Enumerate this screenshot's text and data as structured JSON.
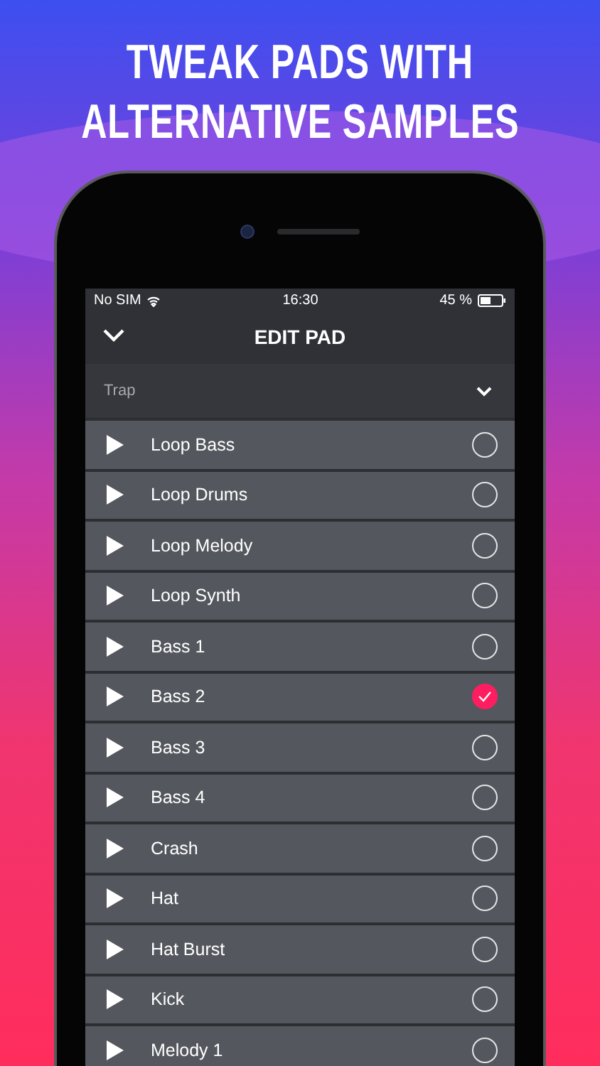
{
  "headline": [
    "TWEAK PADS WITH",
    "ALTERNATIVE SAMPLES"
  ],
  "status_bar": {
    "carrier": "No SIM",
    "time": "16:30",
    "battery": "45 %"
  },
  "header": {
    "title": "EDIT PAD"
  },
  "category": {
    "label": "Trap"
  },
  "samples": [
    {
      "name": "Loop Bass",
      "selected": false
    },
    {
      "name": "Loop Drums",
      "selected": false
    },
    {
      "name": "Loop Melody",
      "selected": false
    },
    {
      "name": "Loop Synth",
      "selected": false
    },
    {
      "name": "Bass 1",
      "selected": false
    },
    {
      "name": "Bass 2",
      "selected": true
    },
    {
      "name": "Bass 3",
      "selected": false
    },
    {
      "name": "Bass 4",
      "selected": false
    },
    {
      "name": "Crash",
      "selected": false
    },
    {
      "name": "Hat",
      "selected": false
    },
    {
      "name": "Hat Burst",
      "selected": false
    },
    {
      "name": "Kick",
      "selected": false
    },
    {
      "name": "Melody 1",
      "selected": false
    }
  ]
}
